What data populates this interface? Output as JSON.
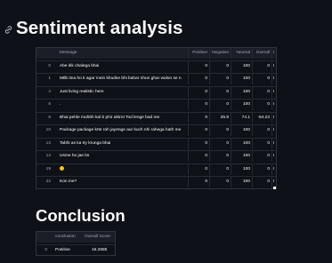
{
  "sentiment": {
    "title": "Sentiment analysis",
    "columns": [
      "",
      "Message",
      "Positive",
      "Negative",
      "Neutral",
      "Overall",
      "I"
    ],
    "rows": [
      {
        "idx": "0",
        "message": "Abe itik chalega bhai",
        "positive": "0",
        "negative": "0",
        "neutral": "100",
        "overall": "0",
        "extra": "I"
      },
      {
        "idx": "1",
        "message": "Mtlb itna ho k agar mein khudse bhi bahar nhun ghar walon se n",
        "positive": "0",
        "negative": "0",
        "neutral": "100",
        "overall": "0",
        "extra": "I"
      },
      {
        "idx": "4",
        "message": "Just living realistic here",
        "positive": "0",
        "negative": "0",
        "neutral": "100",
        "overall": "0",
        "extra": "I"
      },
      {
        "idx": "5",
        "message": ".",
        "positive": "0",
        "negative": "0",
        "neutral": "100",
        "overall": "0",
        "extra": "I"
      },
      {
        "idx": "8",
        "message": "Bhai pehle muhbh kal b phir aktrot Tod lenge bad me",
        "positive": "0",
        "negative": "25.9",
        "neutral": "74.1",
        "overall": "-54.23",
        "extra": "I"
      },
      {
        "idx": "10",
        "message": "Package package krte rah jayenge aur kuch nhi rahega hath me",
        "positive": "0",
        "negative": "0",
        "neutral": "100",
        "overall": "0",
        "extra": "I"
      },
      {
        "idx": "12",
        "message": "Tabhi as ka try krunga bhai",
        "positive": "0",
        "negative": "0",
        "neutral": "100",
        "overall": "0",
        "extra": "I"
      },
      {
        "idx": "14",
        "message": "Usme ho jae bs",
        "positive": "0",
        "negative": "0",
        "neutral": "100",
        "overall": "0",
        "extra": "I"
      },
      {
        "idx": "19",
        "message": "",
        "positive": "0",
        "negative": "0",
        "neutral": "100",
        "overall": "0",
        "extra": "I"
      },
      {
        "idx": "22",
        "message": "Kon me?",
        "positive": "0",
        "negative": "0",
        "neutral": "100",
        "overall": "0",
        "extra": "I"
      }
    ]
  },
  "conclusion": {
    "title": "Conclusion",
    "columns": [
      "",
      "conclusion",
      "Overall Score"
    ],
    "rows": [
      {
        "idx": "0",
        "conclusion": "Positive",
        "score": "16.2685"
      }
    ]
  },
  "colors": {
    "background": "#0e1117",
    "text": "#fafafa",
    "muted": "#a3a8b8",
    "border": "#31333f",
    "emoji": "#f5c518"
  },
  "icons": {
    "anchor": "link-icon",
    "emoji": "smiley-emoji"
  }
}
